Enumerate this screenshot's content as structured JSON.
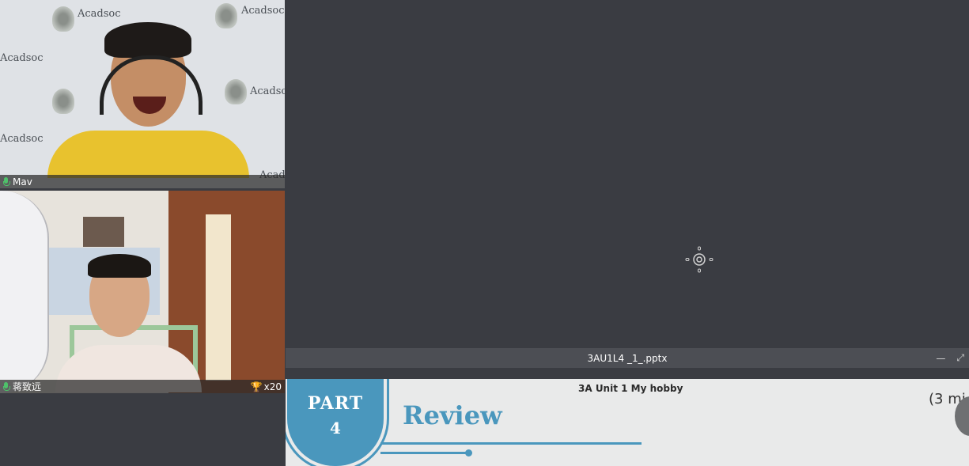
{
  "participants": [
    {
      "name": "Mav",
      "mic": "mic-on-icon"
    },
    {
      "name": "蒋致远",
      "mic": "mic-on-icon",
      "trophy_count": "x20"
    }
  ],
  "tile1_backdrop": {
    "brand": "Acadsoc"
  },
  "document": {
    "filename": "3AU1L4 _1_.pptx",
    "window_buttons": [
      "minimize-icon",
      "maximize-icon"
    ]
  },
  "slide": {
    "header": "3A Unit 1 My hobby",
    "part_label": "PART",
    "part_number": "4",
    "title": "Review",
    "time_note": "(3 mi"
  },
  "colors": {
    "background": "#3a3c42",
    "accent": "#4a97bd",
    "mic": "#4ec16a",
    "trophy": "#f0c030"
  }
}
